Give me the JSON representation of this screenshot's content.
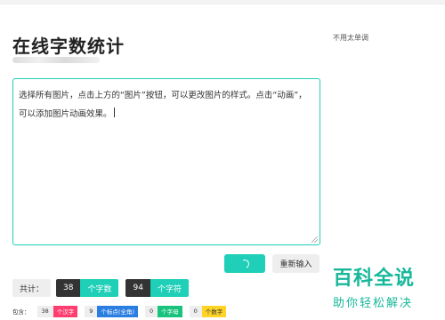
{
  "page": {
    "title": "在线字数统计",
    "side_note": "不用太单调"
  },
  "editor": {
    "text": "选择所有图片，点击上方的“图片”按钮，可以更改图片的样式。点击“动画”，可以添加图片动画效果。"
  },
  "buttons": {
    "count_icon": "spinner-icon",
    "reset_label": "重新输入"
  },
  "stats": {
    "total_label": "共计：",
    "chars": {
      "value": "38",
      "label": "个字数"
    },
    "symbols": {
      "value": "94",
      "label": "个字符"
    }
  },
  "details": {
    "label": "包含：",
    "items": [
      {
        "value": "38",
        "label": "个汉字",
        "color": "#ff3d6e"
      },
      {
        "value": "9",
        "label": "个标点(全角)",
        "color": "#2a7de1"
      },
      {
        "value": "0",
        "label": "个字母",
        "color": "#19c37d"
      },
      {
        "value": "0",
        "label": "个数字",
        "color": "#ffd426"
      }
    ]
  },
  "watermark": {
    "line1": "百科全说",
    "line2": "助你轻松解决"
  },
  "colors": {
    "accent": "#1fcfb8",
    "dark": "#333333",
    "watermark": "#17b89a"
  }
}
